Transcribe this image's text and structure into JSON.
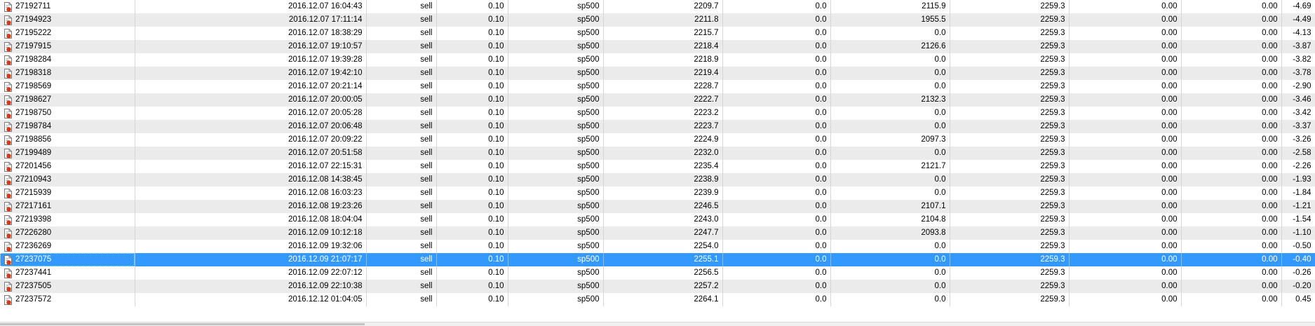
{
  "colors": {
    "selection": "#3399ff",
    "row_alt": "#ebebeb",
    "icon_badge": "#d43a1a"
  },
  "icons": {
    "order": "sell-order-icon"
  },
  "selected_index": 19,
  "rows": [
    {
      "ticket": "27192711",
      "time": "2016.12.07 16:04:43",
      "type": "sell",
      "size": "0.10",
      "symbol": "sp500",
      "price": "2209.7",
      "sl": "0.0",
      "tp": "2115.9",
      "cur_price": "2259.3",
      "commission": "0.00",
      "swap": "0.00",
      "profit": "-4.69"
    },
    {
      "ticket": "27194923",
      "time": "2016.12.07 17:11:14",
      "type": "sell",
      "size": "0.10",
      "symbol": "sp500",
      "price": "2211.8",
      "sl": "0.0",
      "tp": "1955.5",
      "cur_price": "2259.3",
      "commission": "0.00",
      "swap": "0.00",
      "profit": "-4.49"
    },
    {
      "ticket": "27195222",
      "time": "2016.12.07 18:38:29",
      "type": "sell",
      "size": "0.10",
      "symbol": "sp500",
      "price": "2215.7",
      "sl": "0.0",
      "tp": "0.0",
      "cur_price": "2259.3",
      "commission": "0.00",
      "swap": "0.00",
      "profit": "-4.13"
    },
    {
      "ticket": "27197915",
      "time": "2016.12.07 19:10:57",
      "type": "sell",
      "size": "0.10",
      "symbol": "sp500",
      "price": "2218.4",
      "sl": "0.0",
      "tp": "2126.6",
      "cur_price": "2259.3",
      "commission": "0.00",
      "swap": "0.00",
      "profit": "-3.87"
    },
    {
      "ticket": "27198284",
      "time": "2016.12.07 19:39:28",
      "type": "sell",
      "size": "0.10",
      "symbol": "sp500",
      "price": "2218.9",
      "sl": "0.0",
      "tp": "0.0",
      "cur_price": "2259.3",
      "commission": "0.00",
      "swap": "0.00",
      "profit": "-3.82"
    },
    {
      "ticket": "27198318",
      "time": "2016.12.07 19:42:10",
      "type": "sell",
      "size": "0.10",
      "symbol": "sp500",
      "price": "2219.4",
      "sl": "0.0",
      "tp": "0.0",
      "cur_price": "2259.3",
      "commission": "0.00",
      "swap": "0.00",
      "profit": "-3.78"
    },
    {
      "ticket": "27198569",
      "time": "2016.12.07 20:21:14",
      "type": "sell",
      "size": "0.10",
      "symbol": "sp500",
      "price": "2228.7",
      "sl": "0.0",
      "tp": "0.0",
      "cur_price": "2259.3",
      "commission": "0.00",
      "swap": "0.00",
      "profit": "-2.90"
    },
    {
      "ticket": "27198627",
      "time": "2016.12.07 20:00:05",
      "type": "sell",
      "size": "0.10",
      "symbol": "sp500",
      "price": "2222.7",
      "sl": "0.0",
      "tp": "2132.3",
      "cur_price": "2259.3",
      "commission": "0.00",
      "swap": "0.00",
      "profit": "-3.46"
    },
    {
      "ticket": "27198750",
      "time": "2016.12.07 20:05:28",
      "type": "sell",
      "size": "0.10",
      "symbol": "sp500",
      "price": "2223.2",
      "sl": "0.0",
      "tp": "0.0",
      "cur_price": "2259.3",
      "commission": "0.00",
      "swap": "0.00",
      "profit": "-3.42"
    },
    {
      "ticket": "27198784",
      "time": "2016.12.07 20:06:48",
      "type": "sell",
      "size": "0.10",
      "symbol": "sp500",
      "price": "2223.7",
      "sl": "0.0",
      "tp": "0.0",
      "cur_price": "2259.3",
      "commission": "0.00",
      "swap": "0.00",
      "profit": "-3.37"
    },
    {
      "ticket": "27198856",
      "time": "2016.12.07 20:09:22",
      "type": "sell",
      "size": "0.10",
      "symbol": "sp500",
      "price": "2224.9",
      "sl": "0.0",
      "tp": "2097.3",
      "cur_price": "2259.3",
      "commission": "0.00",
      "swap": "0.00",
      "profit": "-3.26"
    },
    {
      "ticket": "27199489",
      "time": "2016.12.07 20:51:58",
      "type": "sell",
      "size": "0.10",
      "symbol": "sp500",
      "price": "2232.0",
      "sl": "0.0",
      "tp": "0.0",
      "cur_price": "2259.3",
      "commission": "0.00",
      "swap": "0.00",
      "profit": "-2.58"
    },
    {
      "ticket": "27201456",
      "time": "2016.12.07 22:15:31",
      "type": "sell",
      "size": "0.10",
      "symbol": "sp500",
      "price": "2235.4",
      "sl": "0.0",
      "tp": "2121.7",
      "cur_price": "2259.3",
      "commission": "0.00",
      "swap": "0.00",
      "profit": "-2.26"
    },
    {
      "ticket": "27210943",
      "time": "2016.12.08 14:38:45",
      "type": "sell",
      "size": "0.10",
      "symbol": "sp500",
      "price": "2238.9",
      "sl": "0.0",
      "tp": "0.0",
      "cur_price": "2259.3",
      "commission": "0.00",
      "swap": "0.00",
      "profit": "-1.93"
    },
    {
      "ticket": "27215939",
      "time": "2016.12.08 16:03:23",
      "type": "sell",
      "size": "0.10",
      "symbol": "sp500",
      "price": "2239.9",
      "sl": "0.0",
      "tp": "0.0",
      "cur_price": "2259.3",
      "commission": "0.00",
      "swap": "0.00",
      "profit": "-1.84"
    },
    {
      "ticket": "27217161",
      "time": "2016.12.08 19:23:26",
      "type": "sell",
      "size": "0.10",
      "symbol": "sp500",
      "price": "2246.5",
      "sl": "0.0",
      "tp": "2107.1",
      "cur_price": "2259.3",
      "commission": "0.00",
      "swap": "0.00",
      "profit": "-1.21"
    },
    {
      "ticket": "27219398",
      "time": "2016.12.08 18:04:04",
      "type": "sell",
      "size": "0.10",
      "symbol": "sp500",
      "price": "2243.0",
      "sl": "0.0",
      "tp": "2104.8",
      "cur_price": "2259.3",
      "commission": "0.00",
      "swap": "0.00",
      "profit": "-1.54"
    },
    {
      "ticket": "27226280",
      "time": "2016.12.09 10:12:18",
      "type": "sell",
      "size": "0.10",
      "symbol": "sp500",
      "price": "2247.7",
      "sl": "0.0",
      "tp": "2093.8",
      "cur_price": "2259.3",
      "commission": "0.00",
      "swap": "0.00",
      "profit": "-1.10"
    },
    {
      "ticket": "27236269",
      "time": "2016.12.09 19:32:06",
      "type": "sell",
      "size": "0.10",
      "symbol": "sp500",
      "price": "2254.0",
      "sl": "0.0",
      "tp": "0.0",
      "cur_price": "2259.3",
      "commission": "0.00",
      "swap": "0.00",
      "profit": "-0.50"
    },
    {
      "ticket": "27237075",
      "time": "2016.12.09 21:07:17",
      "type": "sell",
      "size": "0.10",
      "symbol": "sp500",
      "price": "2255.1",
      "sl": "0.0",
      "tp": "0.0",
      "cur_price": "2259.3",
      "commission": "0.00",
      "swap": "0.00",
      "profit": "-0.40"
    },
    {
      "ticket": "27237441",
      "time": "2016.12.09 22:07:12",
      "type": "sell",
      "size": "0.10",
      "symbol": "sp500",
      "price": "2256.5",
      "sl": "0.0",
      "tp": "0.0",
      "cur_price": "2259.3",
      "commission": "0.00",
      "swap": "0.00",
      "profit": "-0.26"
    },
    {
      "ticket": "27237505",
      "time": "2016.12.09 22:10:38",
      "type": "sell",
      "size": "0.10",
      "symbol": "sp500",
      "price": "2257.2",
      "sl": "0.0",
      "tp": "0.0",
      "cur_price": "2259.3",
      "commission": "0.00",
      "swap": "0.00",
      "profit": "-0.20"
    },
    {
      "ticket": "27237572",
      "time": "2016.12.12 01:04:05",
      "type": "sell",
      "size": "0.10",
      "symbol": "sp500",
      "price": "2264.1",
      "sl": "0.0",
      "tp": "0.0",
      "cur_price": "2259.3",
      "commission": "0.00",
      "swap": "0.00",
      "profit": "0.45"
    }
  ]
}
